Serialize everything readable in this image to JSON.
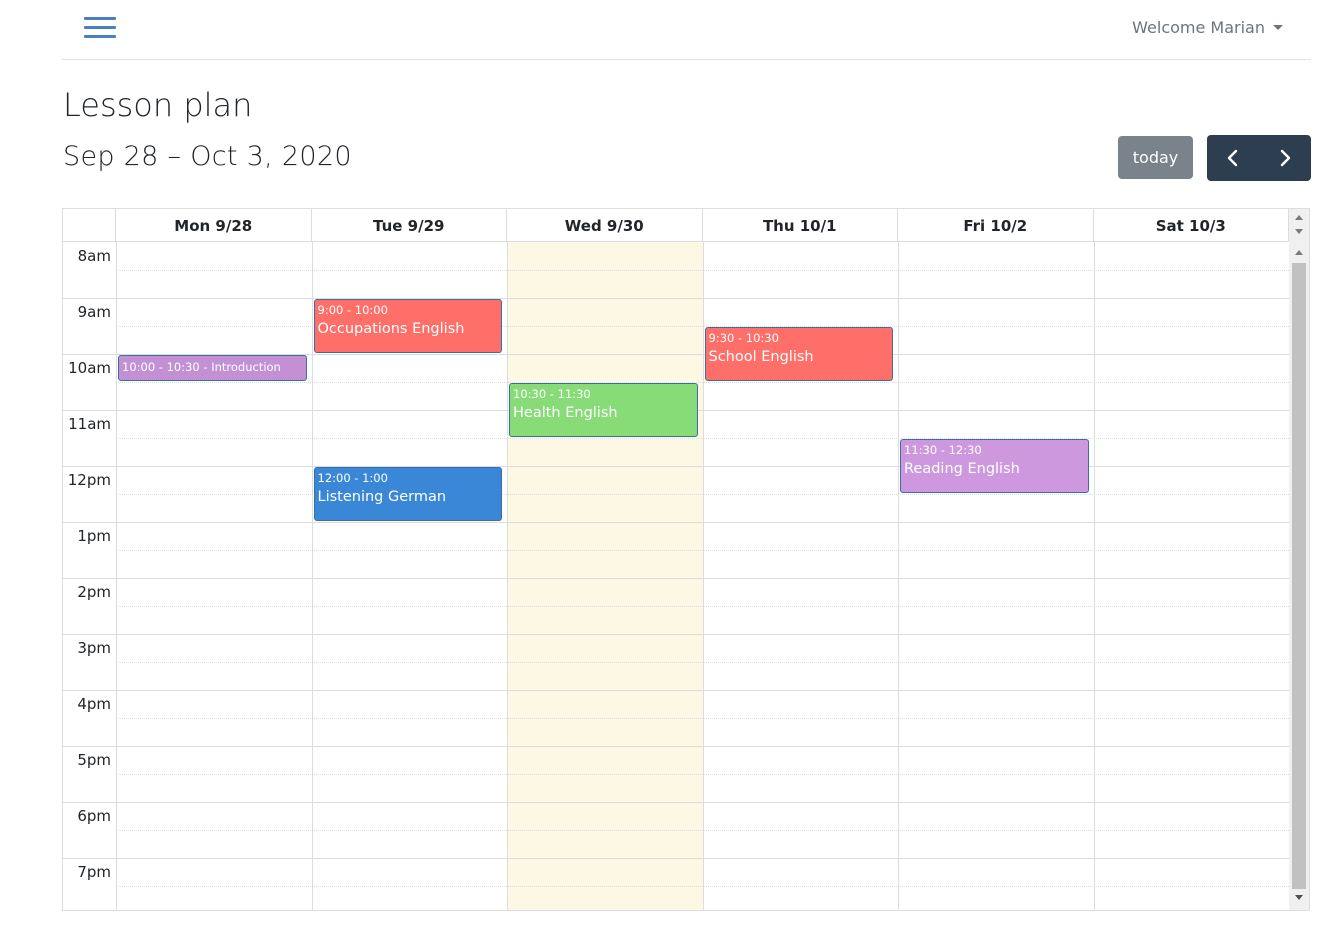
{
  "header": {
    "welcome_label": "Welcome Marian"
  },
  "page": {
    "title": "Lesson plan",
    "range": "Sep 28 – Oct 3, 2020"
  },
  "toolbar": {
    "today_label": "today",
    "prev_icon": "chevron-left-icon",
    "next_icon": "chevron-right-icon",
    "nav_color": "#2c3e50",
    "today_color": "#7a838b"
  },
  "calendar": {
    "days": [
      "Mon 9/28",
      "Tue 9/29",
      "Wed 9/30",
      "Thu 10/1",
      "Fri 10/2",
      "Sat 10/3"
    ],
    "today_index": 2,
    "today_highlight": "#fcf8e3",
    "hours": [
      "8am",
      "9am",
      "10am",
      "11am",
      "12pm",
      "1pm",
      "2pm",
      "3pm",
      "4pm",
      "5pm",
      "6pm",
      "7pm"
    ],
    "events": [
      {
        "day": 0,
        "start": 10.0,
        "end": 10.5,
        "time": "10:00 - 10:30 - Introduction",
        "title": "",
        "color": "#c390d4",
        "compact": true
      },
      {
        "day": 1,
        "start": 9.0,
        "end": 10.0,
        "time": "9:00 - 10:00",
        "title": "Occupations English",
        "color": "#ff6f69"
      },
      {
        "day": 1,
        "start": 12.0,
        "end": 13.0,
        "time": "12:00 - 1:00",
        "title": "Listening German",
        "color": "#3a87d8"
      },
      {
        "day": 2,
        "start": 10.5,
        "end": 11.5,
        "time": "10:30 - 11:30",
        "title": "Health English",
        "color": "#88dc78"
      },
      {
        "day": 3,
        "start": 9.5,
        "end": 10.5,
        "time": "9:30 - 10:30",
        "title": "School English",
        "color": "#ff6f69"
      },
      {
        "day": 4,
        "start": 11.5,
        "end": 12.5,
        "time": "11:30 - 12:30",
        "title": "Reading English",
        "color": "#cd98de"
      }
    ]
  }
}
